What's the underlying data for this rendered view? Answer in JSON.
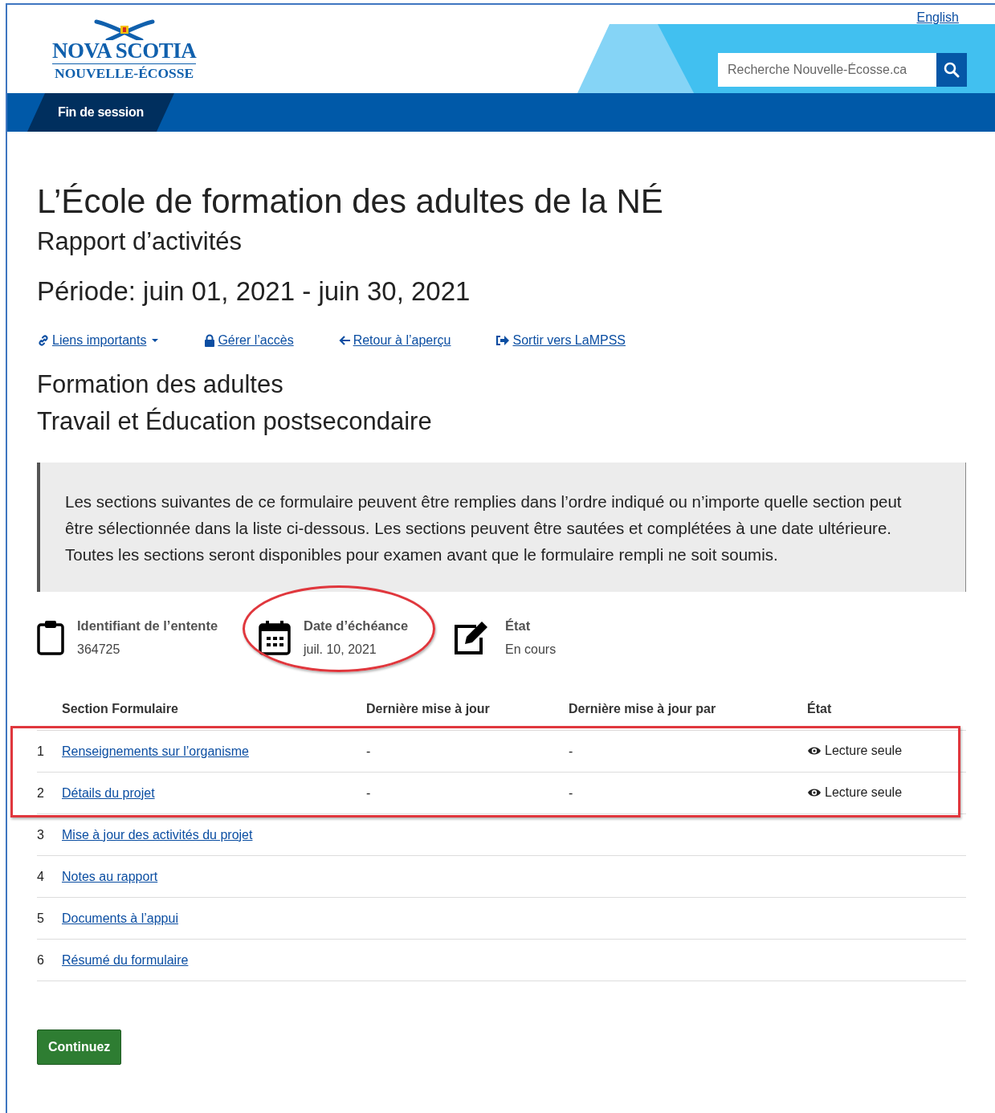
{
  "header": {
    "language_link": "English",
    "logo": {
      "line_1": "NOVA SCOTIA",
      "line_2": "NOUVELLE-ÉCOSSE"
    },
    "search": {
      "placeholder": "Recherche Nouvelle-Écosse.ca"
    },
    "nav": [
      {
        "label": "Fin de session",
        "selected": true
      }
    ]
  },
  "title": "L’École de formation des adultes de la NÉ",
  "subtitle": "Rapport d’activités",
  "period": "Période: juin 01, 2021 - juin 30, 2021",
  "links": [
    {
      "kind": "link",
      "label": "Liens importants",
      "dropdown": true
    },
    {
      "kind": "lock",
      "label": "Gérer l’accès",
      "dropdown": false
    },
    {
      "kind": "back",
      "label": "Retour à l’aperçu",
      "dropdown": false
    },
    {
      "kind": "exit",
      "label": "Sortir vers LaMPSS",
      "dropdown": false
    }
  ],
  "program": "Formation des adultes",
  "department": "Travail et Éducation postsecondaire",
  "notice": "Les sections suivantes de ce formulaire peuvent être remplies dans l’ordre indiqué ou n’importe quelle section peut être sélectionnée dans la liste ci-dessous. Les sections peuvent être sautées et complétées à une date ultérieure. Toutes les sections seront disponibles pour examen avant que le formulaire rempli ne soit soumis.",
  "info": [
    {
      "kind": "clipboard",
      "label": "Identifiant de l’entente",
      "value": "364725",
      "circled": false
    },
    {
      "kind": "calendar",
      "label": "Date d’échéance",
      "value": "juil. 10, 2021",
      "circled": true
    },
    {
      "kind": "edit",
      "label": "État",
      "value": "En cours",
      "circled": false
    }
  ],
  "table": {
    "columns": [
      "Section Formulaire",
      "Dernière mise à jour",
      "Dernière mise à jour par",
      "État"
    ],
    "rows": [
      {
        "number": "1",
        "section": "Renseignements sur l’organisme",
        "updated": "-",
        "updated_by": "-",
        "status": "Lecture seule",
        "highlighted": true
      },
      {
        "number": "2",
        "section": "Détails du projet",
        "updated": "-",
        "updated_by": "-",
        "status": "Lecture seule",
        "highlighted": true
      },
      {
        "number": "3",
        "section": "Mise à jour des activités du projet",
        "highlighted": false
      },
      {
        "number": "4",
        "section": "Notes au rapport",
        "highlighted": false
      },
      {
        "number": "5",
        "section": "Documents à l’appui",
        "highlighted": false
      },
      {
        "number": "6",
        "section": "Résumé du formulaire",
        "highlighted": false
      }
    ]
  },
  "buttons": [
    "Continuez"
  ]
}
